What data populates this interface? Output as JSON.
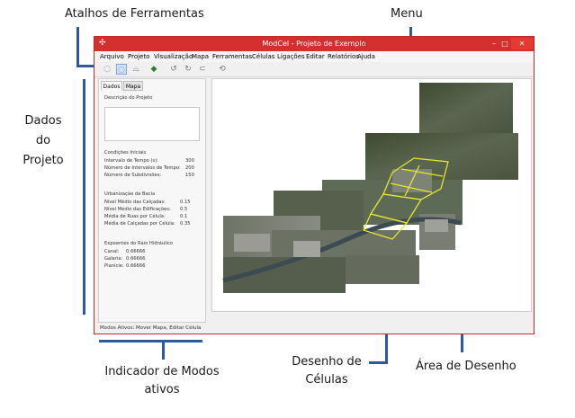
{
  "annotations": {
    "toolbar_shortcuts": "Atalhos de Ferramentas",
    "menu": "Menu",
    "project_data": [
      "Dados",
      "do",
      "Projeto"
    ],
    "active_modes": [
      "Indicador de Modos",
      "ativos"
    ],
    "cell_drawing": [
      "Desenho de",
      "Células"
    ],
    "drawing_area": "Área de Desenho"
  },
  "window": {
    "title": "ModCel - Projeto de Exemplo",
    "minimize": "–",
    "maximize": "□",
    "close": "✕"
  },
  "menu": [
    "Arquivo",
    "Projeto",
    "Visualização",
    "Mapa",
    "Ferramentas",
    "Células",
    "Ligações",
    "Editar",
    "Relatórios",
    "Ajuda"
  ],
  "toolbar": [
    {
      "icon": "select-cell-icon",
      "glyph": "◌"
    },
    {
      "icon": "select-cell-active-icon",
      "glyph": "◌"
    },
    {
      "icon": "cells-icon",
      "glyph": "⌓"
    },
    {
      "icon": "map-move-icon",
      "glyph": "◆"
    },
    {
      "icon": "rotate-left-icon",
      "glyph": "↺"
    },
    {
      "icon": "rotate-combo-icon",
      "glyph": "↻"
    },
    {
      "icon": "link-icon",
      "glyph": "⊂"
    },
    {
      "icon": "refresh-icon",
      "glyph": "⟲"
    }
  ],
  "panel": {
    "tabs": [
      "Dados",
      "Mapa"
    ],
    "description_label": "Descrição do Projeto",
    "initial_conditions": "Condições Iniciais",
    "fields": [
      {
        "label": "Intervalo de Tempo (s):",
        "value": "300"
      },
      {
        "label": "Número de Intervalos de Tempo:",
        "value": "200"
      },
      {
        "label": "Número de Subdivisões:",
        "value": "150"
      }
    ],
    "urbanization": "Urbanização da Bacia",
    "urban_fields": [
      {
        "label": "Nível Médio das Calçadas:",
        "value": "0.15"
      },
      {
        "label": "Nível Médio das Edificações:",
        "value": "0.5"
      },
      {
        "label": "Média de Ruas por Célula:",
        "value": "0.1"
      },
      {
        "label": "Média de Calçadas por Célula:",
        "value": "0.35"
      }
    ],
    "exponents": "Expoentes do Raio Hidráulico",
    "exponent_fields": [
      {
        "label": "Canal:",
        "value": "0.66666"
      },
      {
        "label": "Galeria:",
        "value": "0.66666"
      },
      {
        "label": "Planície:",
        "value": "0.66666"
      }
    ]
  },
  "status": "Modos Ativos: Mover Mapa, Editar Célula",
  "colors": {
    "titlebar": "#d32f2f",
    "callout_line": "#2c5aa0",
    "cell_outline": "#e6e62e"
  }
}
